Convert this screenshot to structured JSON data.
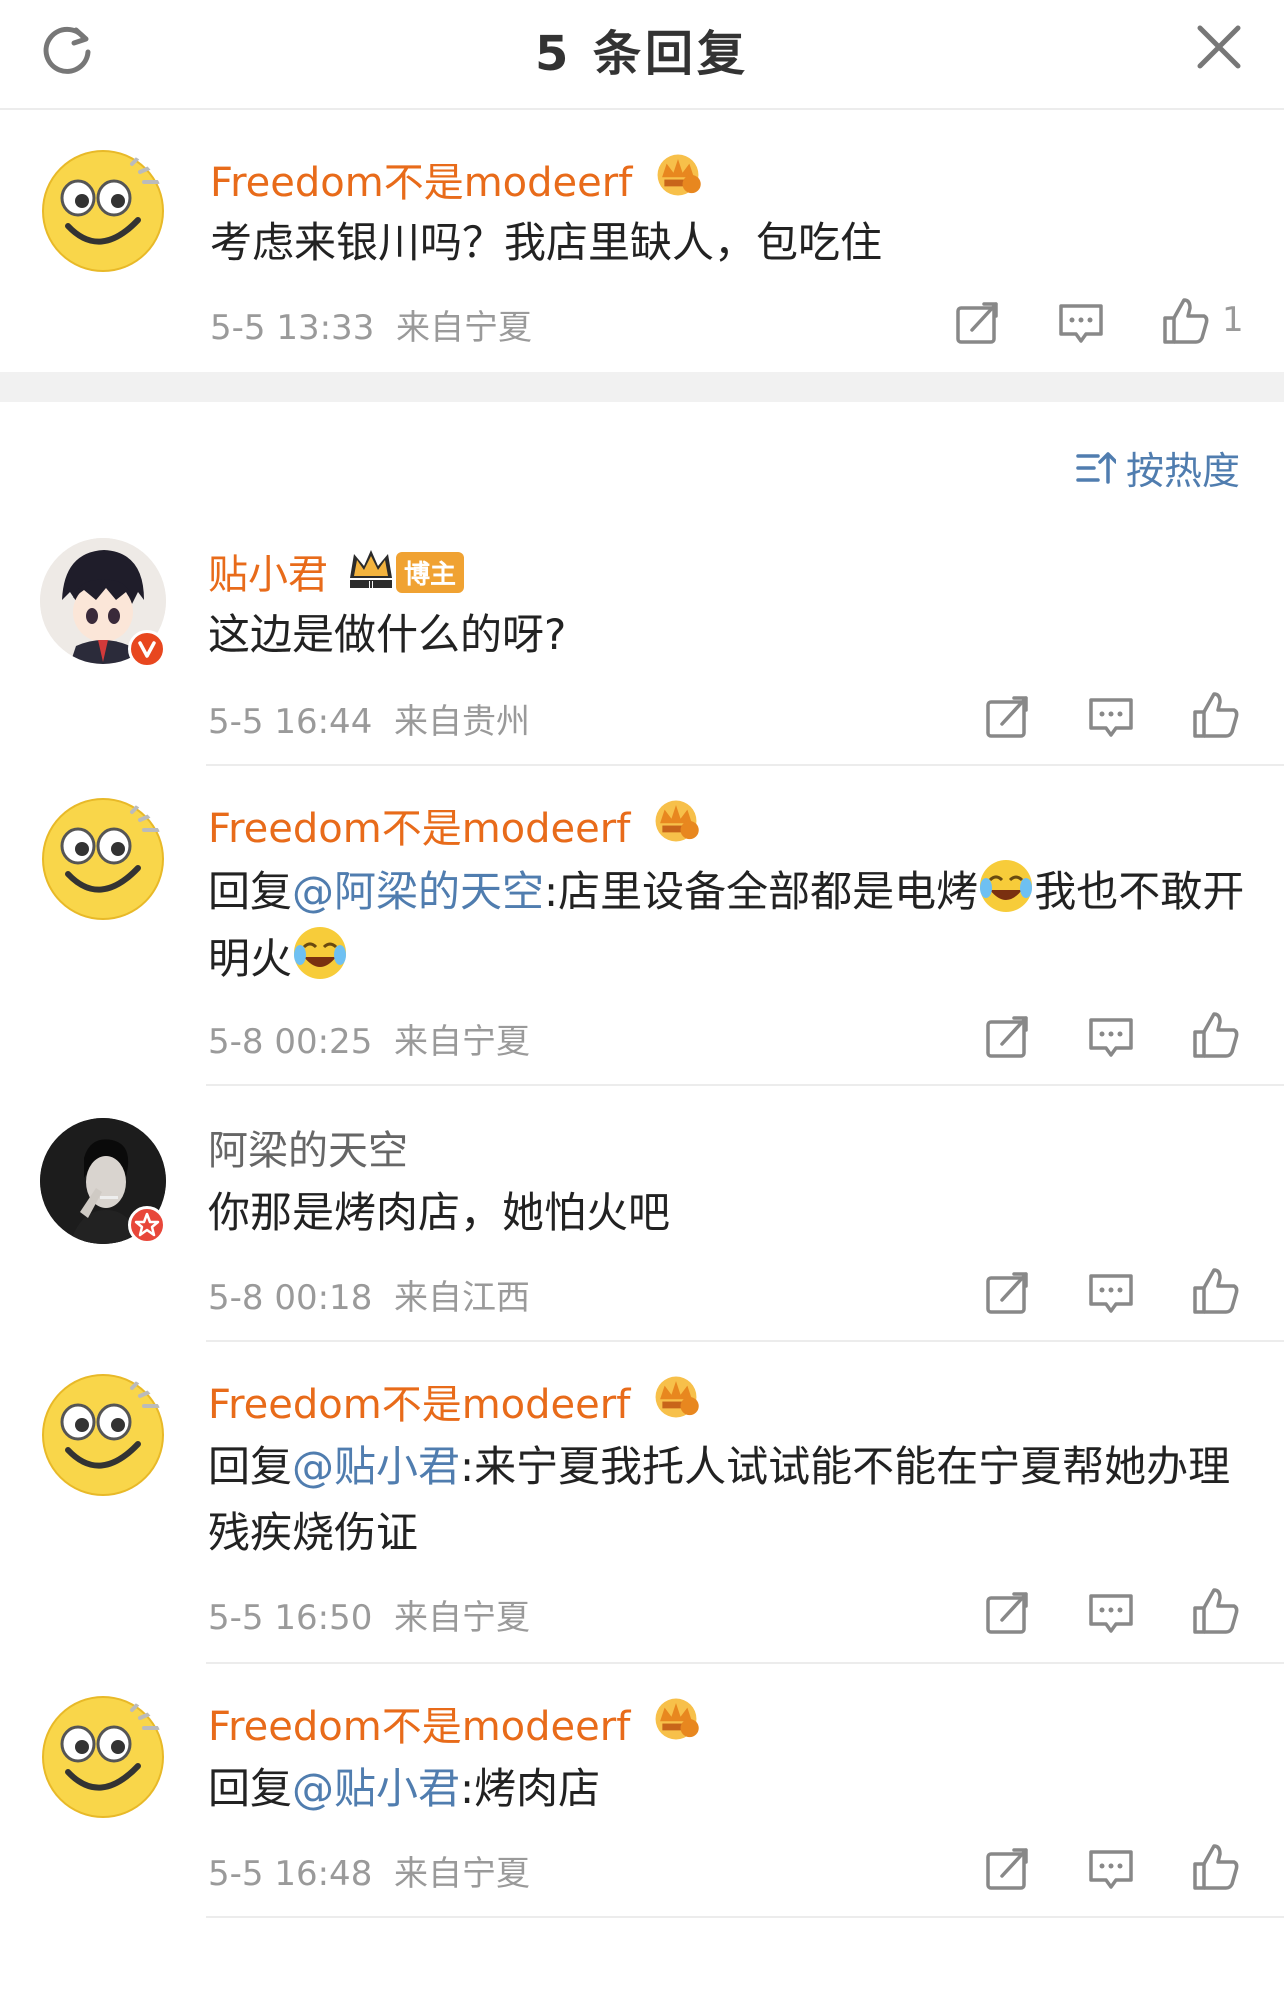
{
  "header": {
    "title": "5 条回复"
  },
  "main_comment": {
    "username": "Freedom不是modeerf",
    "text": "考虑来银川吗？我店里缺人，包吃住",
    "time": "5-5 13:33",
    "location": "来自宁夏",
    "likes": "1"
  },
  "sort_label": "按热度",
  "replies": [
    {
      "username": "贴小君",
      "badge": "博主",
      "text": "这边是做什么的呀?",
      "time": "5-5 16:44",
      "location": "来自贵州"
    },
    {
      "username": "Freedom不是modeerf",
      "prefix": "回复",
      "mention": "@阿梁的天空",
      "text_a": ":店里设备全部都是电烤",
      "text_b": "我也不敢开明火",
      "time": "5-8 00:25",
      "location": "来自宁夏"
    },
    {
      "username": "阿梁的天空",
      "text": "你那是烤肉店，她怕火吧",
      "time": "5-8 00:18",
      "location": "来自江西"
    },
    {
      "username": "Freedom不是modeerf",
      "prefix": "回复",
      "mention": "@贴小君",
      "text_a": ":来宁夏我托人试试能不能在宁夏帮她办理残疾烧伤证",
      "time": "5-5 16:50",
      "location": "来自宁夏"
    },
    {
      "username": "Freedom不是modeerf",
      "prefix": "回复",
      "mention": "@贴小君",
      "text_a": ":烤肉店",
      "time": "5-5 16:48",
      "location": "来自宁夏"
    }
  ],
  "colors": {
    "username_orange": "#e86b1a",
    "link_blue": "#507daf",
    "meta_grey": "#9a9a9a"
  }
}
